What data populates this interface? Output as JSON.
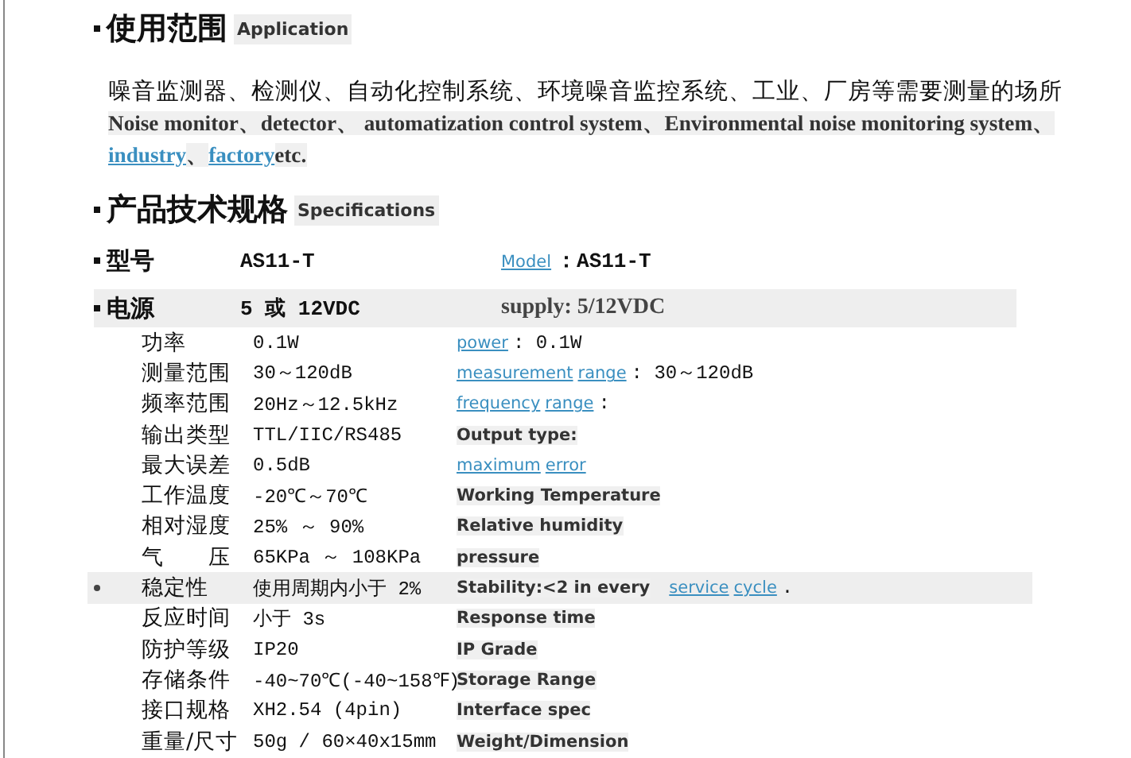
{
  "application": {
    "heading": "使用范围",
    "subheading": "Application",
    "text_cn": "噪音监测器、检测仪、自动化控制系统、环境噪音监控系统、工业、厂房等需要测量的场所",
    "text_en": [
      {
        "kind": "bold",
        "text": "Noise monitor、detector、 automatization control system、Environmental noise monitoring system、"
      },
      {
        "kind": "link",
        "text": "industry"
      },
      {
        "kind": "bold",
        "text": "、"
      },
      {
        "kind": "link",
        "text": "factory"
      },
      {
        "kind": "bold",
        "text": "etc."
      }
    ]
  },
  "specifications": {
    "heading": "产品技术规格",
    "subheading": "Specifications",
    "main_rows": [
      {
        "label": "型号",
        "value": "AS11-T",
        "highlighted": false,
        "english": [
          {
            "kind": "link",
            "text": "Model"
          },
          {
            "kind": "strong",
            "text": "：AS11-T"
          }
        ]
      },
      {
        "label": "电源",
        "value": "5 或 12VDC",
        "highlighted": true,
        "english": [
          {
            "kind": "serif",
            "text": "supply: 5/12VDC"
          }
        ]
      }
    ],
    "rows": [
      {
        "label": "功率",
        "value": "0.1W",
        "bullet": false,
        "highlighted": false,
        "english": [
          {
            "kind": "link",
            "text": "power"
          },
          {
            "kind": "plain",
            "text": ": 0.1W"
          }
        ]
      },
      {
        "label": "测量范围",
        "value": "30～120dB",
        "bullet": false,
        "highlighted": false,
        "english": [
          {
            "kind": "link",
            "text": "measurement"
          },
          {
            "kind": "link",
            "text": "range"
          },
          {
            "kind": "plain",
            "text": ": 30～120dB"
          }
        ]
      },
      {
        "label": "频率范围",
        "value": "20Hz～12.5kHz",
        "bullet": false,
        "highlighted": false,
        "english": [
          {
            "kind": "link",
            "text": "frequency"
          },
          {
            "kind": "link",
            "text": "range"
          },
          {
            "kind": "plain",
            "text": ":"
          }
        ]
      },
      {
        "label": "输出类型",
        "value": "TTL/IIC/RS485",
        "bullet": false,
        "highlighted": false,
        "english": [
          {
            "kind": "bold",
            "text": "Output type:"
          }
        ]
      },
      {
        "label": "最大误差",
        "value": "0.5dB",
        "bullet": false,
        "highlighted": false,
        "english": [
          {
            "kind": "link",
            "text": "maximum"
          },
          {
            "kind": "link",
            "text": "error"
          }
        ]
      },
      {
        "label": "工作温度",
        "value": "-20℃～70℃",
        "bullet": false,
        "highlighted": false,
        "english": [
          {
            "kind": "bold",
            "text": "Working Temperature"
          }
        ]
      },
      {
        "label": "相对湿度",
        "value": "25% ～ 90%",
        "bullet": false,
        "highlighted": false,
        "english": [
          {
            "kind": "bold",
            "text": "Relative humidity"
          }
        ]
      },
      {
        "label": "气　　压",
        "value": "65KPa ～ 108KPa",
        "bullet": false,
        "highlighted": false,
        "english": [
          {
            "kind": "bold",
            "text": "pressure"
          }
        ]
      },
      {
        "label": "稳定性",
        "value": "使用周期内小于 2%",
        "bullet": true,
        "highlighted": true,
        "english": [
          {
            "kind": "bold",
            "text": "Stability:<2 in every"
          },
          {
            "kind": "link",
            "text": "service"
          },
          {
            "kind": "link",
            "text": "cycle"
          },
          {
            "kind": "plain",
            "text": "."
          }
        ]
      },
      {
        "label": "反应时间",
        "value": "小于 3s",
        "bullet": false,
        "highlighted": false,
        "english": [
          {
            "kind": "bold",
            "text": "Response time"
          }
        ]
      },
      {
        "label": "防护等级",
        "value": "IP20",
        "bullet": false,
        "highlighted": false,
        "english": [
          {
            "kind": "bold",
            "text": "IP Grade"
          }
        ]
      },
      {
        "label": "存储条件",
        "value": "-40~70℃(-40~158℉)",
        "bullet": false,
        "highlighted": false,
        "english": [
          {
            "kind": "bold",
            "text": "Storage Range"
          }
        ]
      },
      {
        "label": "接口规格",
        "value": "XH2.54 (4pin)",
        "bullet": false,
        "highlighted": false,
        "english": [
          {
            "kind": "bold",
            "text": "Interface spec"
          }
        ]
      },
      {
        "label": "重量/尺寸",
        "value": "50g / 60×40x15mm",
        "bullet": false,
        "highlighted": false,
        "english": [
          {
            "kind": "bold",
            "text": "Weight/Dimension"
          }
        ]
      }
    ]
  }
}
